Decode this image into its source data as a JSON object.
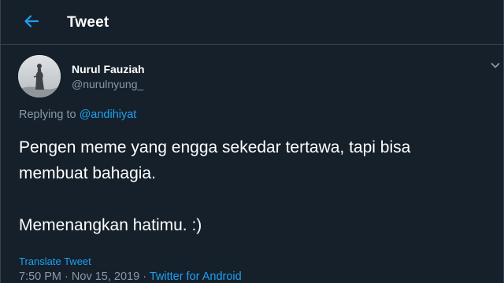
{
  "colors": {
    "background": "#15202b",
    "accent": "#1da1f2",
    "secondary_text": "#8899a6",
    "divider": "#38444d"
  },
  "header": {
    "back_icon": "arrow-left-icon",
    "title": "Tweet"
  },
  "author": {
    "display_name": "Nurul Fauziah",
    "handle": "@nurulnyung_",
    "menu_icon": "chevron-down-icon"
  },
  "reply": {
    "prefix": "Replying to",
    "mention": "@andihiyat"
  },
  "tweet": {
    "lines": [
      "Pengen meme yang engga sekedar tertawa, tapi bisa",
      "membuat bahagia.",
      "Memenangkan hatimu. :)"
    ]
  },
  "translate_label": "Translate Tweet",
  "meta": {
    "time": "7:50 PM",
    "separator": "·",
    "date": "Nov 15, 2019",
    "source": "Twitter for Android"
  }
}
